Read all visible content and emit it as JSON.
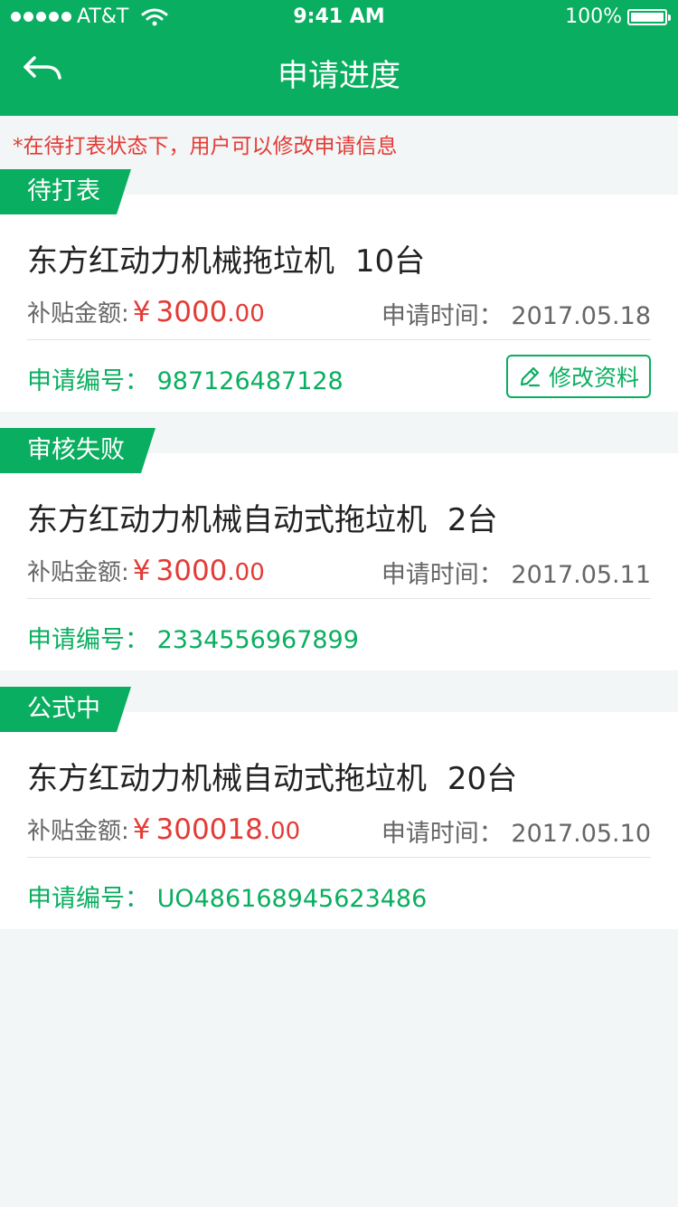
{
  "status_bar": {
    "carrier": "AT&T",
    "time": "9:41 AM",
    "battery": "100%"
  },
  "nav": {
    "title": "申请进度"
  },
  "notice": "*在待打表状态下，用户可以修改申请信息",
  "labels": {
    "subsidy": "补贴金额:",
    "apply_time": "申请时间：",
    "apply_no": "申请编号：",
    "currency": "¥",
    "edit_button": "修改资料"
  },
  "cards": [
    {
      "status": "待打表",
      "name": "东方红动力机械拖垃机",
      "quantity": "10台",
      "amount_int": "3000",
      "amount_dec": ".00",
      "date": "2017.05.18",
      "app_no": "987126487128",
      "editable": true
    },
    {
      "status": "审核失败",
      "name": "东方红动力机械自动式拖垃机",
      "quantity": "2台",
      "amount_int": "3000",
      "amount_dec": ".00",
      "date": "2017.05.11",
      "app_no": "2334556967899",
      "editable": false
    },
    {
      "status": "公式中",
      "name": "东方红动力机械自动式拖垃机",
      "quantity": "20台",
      "amount_int": "300018",
      "amount_dec": ".00",
      "date": "2017.05.10",
      "app_no": "UO486168945623486",
      "editable": false
    }
  ],
  "colors": {
    "brand": "#0aae60",
    "accent_red": "#e33b36"
  },
  "icons": {
    "back": "back-arrow-icon",
    "edit": "pencil-icon",
    "wifi": "wifi-icon",
    "battery": "battery-icon",
    "signal": "signal-dots-icon"
  }
}
